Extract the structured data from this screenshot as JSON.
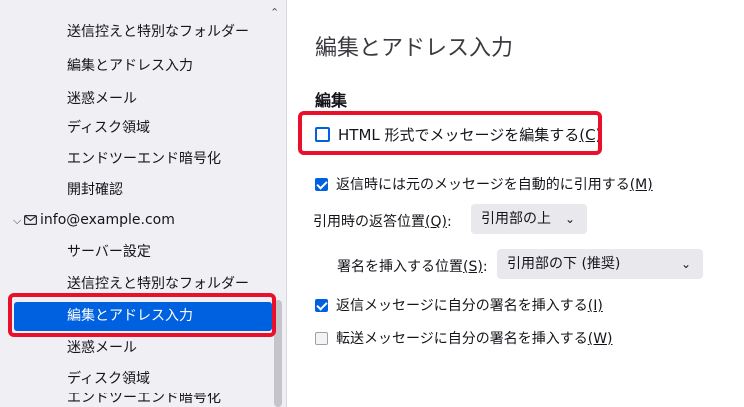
{
  "sidebar": {
    "items": [
      {
        "label": "送信控えと特別なフォルダー"
      },
      {
        "label": "編集とアドレス入力"
      },
      {
        "label": "迷惑メール"
      },
      {
        "label": "ディスク領域"
      },
      {
        "label": "エンドツーエンド暗号化"
      },
      {
        "label": "開封確認"
      },
      {
        "label": "info@example.com",
        "expand_icon": "chevron-down-icon",
        "icon": "mail-icon"
      },
      {
        "label": "サーバー設定"
      },
      {
        "label": "送信控えと特別なフォルダー"
      },
      {
        "label": "編集とアドレス入力",
        "selected": true
      },
      {
        "label": "迷惑メール"
      },
      {
        "label": "ディスク領域"
      },
      {
        "label": "エンドツーエンド暗号化"
      }
    ],
    "scroll_up_icon": "caret-up-icon"
  },
  "main": {
    "title": "編集とアドレス入力",
    "section": "編集",
    "html_compose": {
      "label": "HTML 形式でメッセージを編集する",
      "accesskey": "(C)",
      "checked": false
    },
    "auto_quote": {
      "label": "返信時には元のメッセージを自動的に引用する",
      "accesskey": "(M)",
      "checked": true
    },
    "reply_position": {
      "label": "引用時の返答位置",
      "accesskey": "(Q)",
      "colon": ":",
      "value": "引用部の上"
    },
    "signature_position": {
      "label": "署名を挿入する位置",
      "accesskey": "(S)",
      "colon": ":",
      "value": "引用部の下 (推奨)"
    },
    "sig_reply": {
      "label": "返信メッセージに自分の署名を挿入する",
      "accesskey": "(I)",
      "checked": true
    },
    "sig_forward": {
      "label": "転送メッセージに自分の署名を挿入する",
      "accesskey": "(W)",
      "checked": false
    }
  },
  "colors": {
    "accent": "#0061e0",
    "highlight": "#e8102a"
  }
}
